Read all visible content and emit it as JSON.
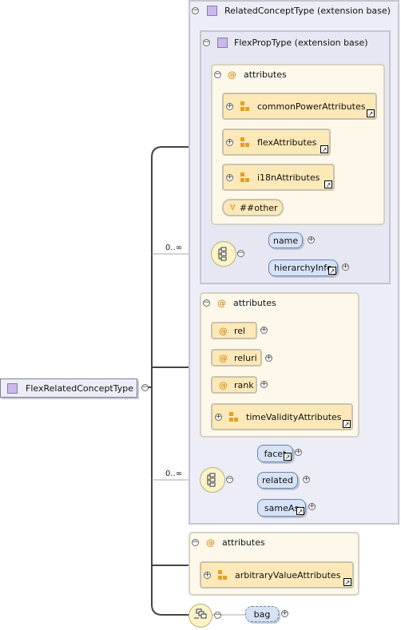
{
  "root": {
    "label": "FlexRelatedConceptType"
  },
  "related_concept": {
    "label": "RelatedConceptType (extension base)"
  },
  "flexprop": {
    "label": "FlexPropType (extension base)",
    "attributes_label": "attributes",
    "groups": [
      "commonPowerAttributes",
      "flexAttributes",
      "i18nAttributes"
    ],
    "any_attr": "##other",
    "occurrence": "0..∞",
    "elements": [
      "name",
      "hierarchyInfo"
    ]
  },
  "related_attrs": {
    "attributes_label": "attributes",
    "attrs": [
      "rel",
      "reluri",
      "rank"
    ],
    "group": "timeValidityAttributes"
  },
  "related_seq": {
    "occurrence": "0..∞",
    "elements": [
      "facet",
      "related",
      "sameAs"
    ]
  },
  "flex_attrs": {
    "attributes_label": "attributes",
    "group": "arbitraryValueAttributes"
  },
  "bag": {
    "label": "bag"
  }
}
